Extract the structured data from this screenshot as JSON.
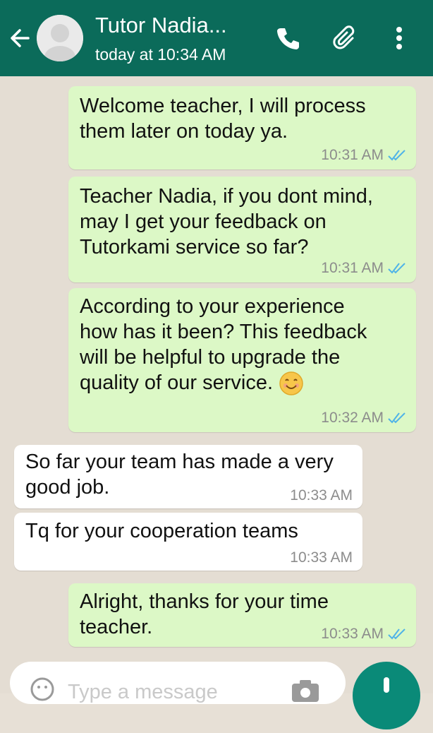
{
  "header": {
    "contact_name": "Tutor Nadia...",
    "last_seen": "today at 10:34 AM",
    "icons": [
      "back-arrow-icon",
      "avatar",
      "phone-icon",
      "paperclip-icon",
      "more-vert-icon"
    ],
    "bar_color": "#0b6b5a"
  },
  "messages": [
    {
      "direction": "out",
      "text": "Welcome teacher, I will process\nthem later on today ya.",
      "time": "10:31 AM",
      "read": true
    },
    {
      "direction": "out",
      "text": "Teacher Nadia, if you dont mind,\nmay I get your feedback on\nTutorkami service so far?",
      "time": "10:31 AM",
      "read": true
    },
    {
      "direction": "out",
      "text": "According to your experience\nhow has it been? This feedback\nwill be helpful to upgrade the\nquality of our service.",
      "emoji": "smiling-face-icon",
      "time": "10:32 AM",
      "read": true
    },
    {
      "direction": "in",
      "text": "So far your team has made a very\ngood job.",
      "time": "10:33 AM"
    },
    {
      "direction": "in",
      "text": "Tq for your cooperation teams",
      "time": "10:33 AM"
    },
    {
      "direction": "out",
      "text": "Alright, thanks for your time\nteacher.",
      "time": "10:33 AM",
      "read": true
    }
  ],
  "composer": {
    "placeholder": "Type a message"
  },
  "colors": {
    "outgoing_bubble": "#dcf8c6",
    "incoming_bubble": "#ffffff",
    "read_tick": "#4fb3e8",
    "chat_background": "#e4ddd3"
  }
}
